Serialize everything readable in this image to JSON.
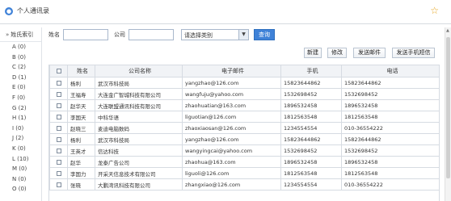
{
  "app": {
    "title": "个人通讯录",
    "icon": "person-icon"
  },
  "star_icon": "star-icon",
  "sidebar": {
    "header": "姓氏索引",
    "letters": [
      {
        "label": "A (0)"
      },
      {
        "label": "B (0)"
      },
      {
        "label": "C (2)"
      },
      {
        "label": "D (1)"
      },
      {
        "label": "E (0)"
      },
      {
        "label": "F (0)"
      },
      {
        "label": "G (2)"
      },
      {
        "label": "H (1)"
      },
      {
        "label": "I (0)"
      },
      {
        "label": "J (2)"
      },
      {
        "label": "K (0)"
      },
      {
        "label": "L (10)"
      },
      {
        "label": "M (0)"
      },
      {
        "label": "N (0)"
      },
      {
        "label": "O (0)"
      }
    ]
  },
  "search": {
    "name_label": "姓名",
    "name_value": "",
    "company_label": "公司",
    "company_value": "",
    "category_select": "请选择类别",
    "query_button": "查询"
  },
  "toolbar": {
    "new": "新建",
    "edit": "修改",
    "send_email": "发送邮件",
    "send_sms": "发送手机短信"
  },
  "table": {
    "headers": [
      "姓名",
      "公司名称",
      "电子邮件",
      "手机",
      "电话"
    ],
    "rows": [
      {
        "name": "杨利",
        "company": "武汉市科技局",
        "email": "yangzhao@126.com",
        "mobile": "15823644862",
        "phone": "15823644862"
      },
      {
        "name": "王福寿",
        "company": "大连金广智城科技有限公司",
        "email": "wangfuju@yahoo.com",
        "mobile": "1532698452",
        "phone": "1532698452"
      },
      {
        "name": "赵华天",
        "company": "大连联盟通讯科技有限公司",
        "email": "zhaohuatian@163.com",
        "mobile": "1896532458",
        "phone": "1896532458"
      },
      {
        "name": "李国天",
        "company": "中科华语",
        "email": "liguotian@126.com",
        "mobile": "1812563548",
        "phone": "1812563548"
      },
      {
        "name": "赵晓三",
        "company": "麦迪电脑数码",
        "email": "zhaoxiaosan@126.com",
        "mobile": "1234554554",
        "phone": "010-36554222"
      },
      {
        "name": "杨利",
        "company": "武汉市科技局",
        "email": "yangzhao@126.com",
        "mobile": "15823644862",
        "phone": "15823644862"
      },
      {
        "name": "王英才",
        "company": "信达科技",
        "email": "wangyingcai@yahoo.com",
        "mobile": "1532698452",
        "phone": "1532698452"
      },
      {
        "name": "赵华",
        "company": "龙泰广告公司",
        "email": "zhaohua@163.com",
        "mobile": "1896532458",
        "phone": "1896532458"
      },
      {
        "name": "李国力",
        "company": "开采天信息技术有限公司",
        "email": "liguoli@126.com",
        "mobile": "1812563548",
        "phone": "1812563548"
      },
      {
        "name": "张晓",
        "company": "大鹏湾讯科技有限公司",
        "email": "zhangxiao@126.com",
        "mobile": "1234554554",
        "phone": "010-36554222"
      }
    ]
  }
}
